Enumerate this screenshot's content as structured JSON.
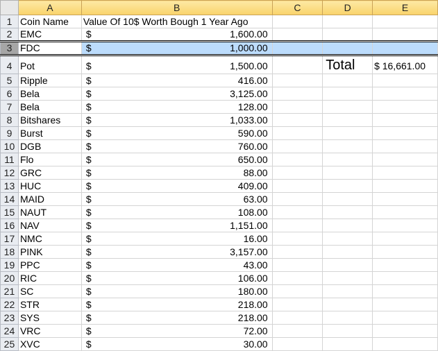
{
  "columns": [
    "A",
    "B",
    "C",
    "D",
    "E"
  ],
  "header": {
    "row": "1",
    "a": "Coin Name",
    "b": "Value Of 10$ Worth Bough 1 Year Ago"
  },
  "currency": "$",
  "rows": [
    {
      "n": "2",
      "coin": "EMC",
      "value": "1,600.00"
    },
    {
      "n": "3",
      "coin": "FDC",
      "value": "1,000.00"
    },
    {
      "n": "4",
      "coin": "Pot",
      "value": "1,500.00"
    },
    {
      "n": "5",
      "coin": "Ripple",
      "value": "416.00"
    },
    {
      "n": "6",
      "coin": "Bela",
      "value": "3,125.00"
    },
    {
      "n": "7",
      "coin": "Bela",
      "value": "128.00"
    },
    {
      "n": "8",
      "coin": "Bitshares",
      "value": "1,033.00"
    },
    {
      "n": "9",
      "coin": "Burst",
      "value": "590.00"
    },
    {
      "n": "10",
      "coin": "DGB",
      "value": "760.00"
    },
    {
      "n": "11",
      "coin": "Flo",
      "value": "650.00"
    },
    {
      "n": "12",
      "coin": "GRC",
      "value": "88.00"
    },
    {
      "n": "13",
      "coin": "HUC",
      "value": "409.00"
    },
    {
      "n": "14",
      "coin": "MAID",
      "value": "63.00"
    },
    {
      "n": "15",
      "coin": "NAUT",
      "value": "108.00"
    },
    {
      "n": "16",
      "coin": "NAV",
      "value": "1,151.00"
    },
    {
      "n": "17",
      "coin": "NMC",
      "value": "16.00"
    },
    {
      "n": "18",
      "coin": "PINK",
      "value": "3,157.00"
    },
    {
      "n": "19",
      "coin": "PPC",
      "value": "43.00"
    },
    {
      "n": "20",
      "coin": "RIC",
      "value": "106.00"
    },
    {
      "n": "21",
      "coin": "SC",
      "value": "180.00"
    },
    {
      "n": "22",
      "coin": "STR",
      "value": "218.00"
    },
    {
      "n": "23",
      "coin": "SYS",
      "value": "218.00"
    },
    {
      "n": "24",
      "coin": "VRC",
      "value": "72.00"
    },
    {
      "n": "25",
      "coin": "XVC",
      "value": "30.00"
    }
  ],
  "total": {
    "label": "Total",
    "value": "$ 16,661.00"
  },
  "selected_row": "3"
}
